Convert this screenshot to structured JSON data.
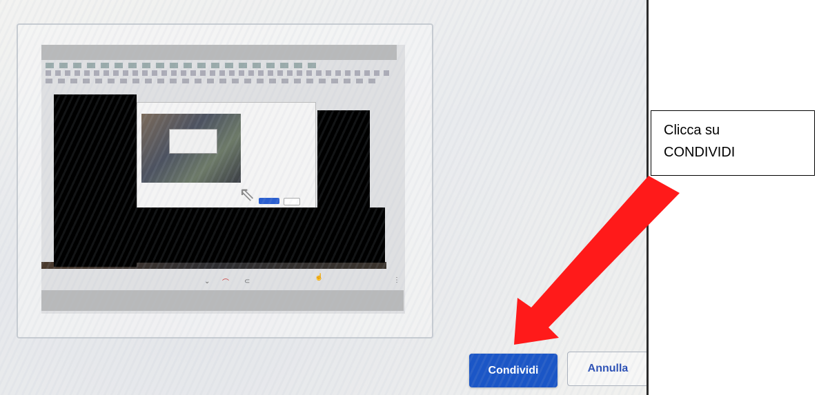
{
  "dialog": {
    "share_label": "Condividi",
    "cancel_label": "Annulla"
  },
  "callout": {
    "line1": "Clicca su",
    "line2": "CONDIVIDI"
  },
  "colors": {
    "primary_button": "#1b56c6",
    "arrow": "#ff1a1a",
    "redaction": "#000000"
  }
}
